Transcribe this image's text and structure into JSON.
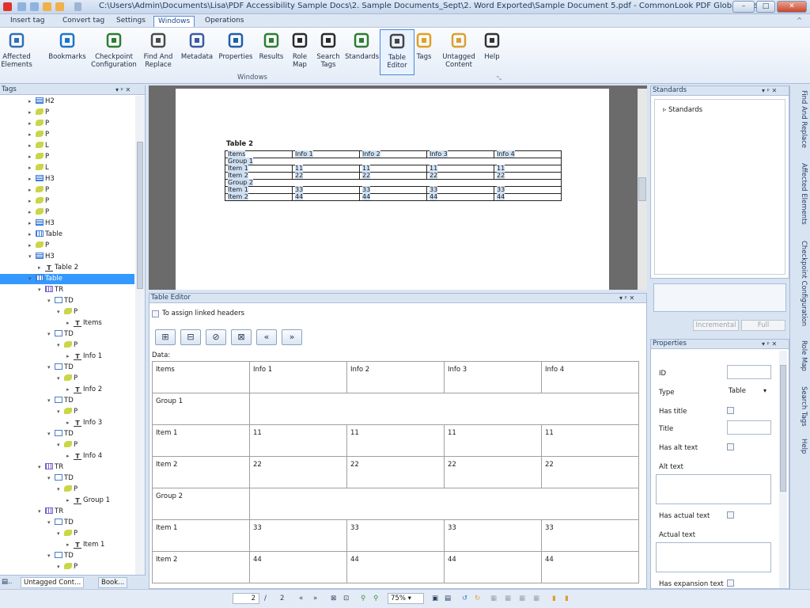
{
  "window": {
    "title": "C:\\Users\\Admin\\Documents\\Lisa\\PDF Accessibility Sample Docs\\2. Sample Documents_Sept\\2. Word Exported\\Sample Document 5.pdf - CommonLook PDF GlobalAccess",
    "min": "–",
    "max": "□",
    "close": "✕"
  },
  "menu": [
    "Insert tag",
    "Convert tag",
    "Settings",
    "Windows",
    "Operations"
  ],
  "ribbon": {
    "buttons": [
      {
        "label": "Affected\nElements",
        "icon": "affected-elements-icon"
      },
      {
        "label": "Bookmarks",
        "icon": "bookmark-icon"
      },
      {
        "label": "Checkpoint\nConfiguration",
        "icon": "checkpoint-icon"
      },
      {
        "label": "Find And\nReplace",
        "icon": "find-replace-icon"
      },
      {
        "label": "Metadata",
        "icon": "metadata-icon"
      },
      {
        "label": "Properties",
        "icon": "properties-icon"
      },
      {
        "label": "Results",
        "icon": "results-icon"
      },
      {
        "label": "Role\nMap",
        "icon": "role-map-icon"
      },
      {
        "label": "Search\nTags",
        "icon": "search-icon"
      },
      {
        "label": "Standards",
        "icon": "standards-icon"
      },
      {
        "label": "Table\nEditor",
        "icon": "table-editor-icon"
      },
      {
        "label": "Tags",
        "icon": "tag-icon"
      },
      {
        "label": "Untagged\nContent",
        "icon": "untagged-icon"
      },
      {
        "label": "Help",
        "icon": "help-icon"
      }
    ],
    "group_label": "Windows"
  },
  "tags_panel": {
    "title": "Tags",
    "pin": "▾ ᵖ ✕",
    "nodes": [
      {
        "label": "H2",
        "type": "h",
        "indent": 0,
        "arrow": "▸"
      },
      {
        "label": "P",
        "type": "p",
        "indent": 0,
        "arrow": "▸"
      },
      {
        "label": "P",
        "type": "p",
        "indent": 0,
        "arrow": "▸"
      },
      {
        "label": "P",
        "type": "p",
        "indent": 0,
        "arrow": "▸"
      },
      {
        "label": "L",
        "type": "l",
        "indent": 0,
        "arrow": "▸"
      },
      {
        "label": "P",
        "type": "p",
        "indent": 0,
        "arrow": "▸"
      },
      {
        "label": "L",
        "type": "l",
        "indent": 0,
        "arrow": "▸"
      },
      {
        "label": "H3",
        "type": "h",
        "indent": 0,
        "arrow": "▸"
      },
      {
        "label": "P",
        "type": "p",
        "indent": 0,
        "arrow": "▸"
      },
      {
        "label": "P",
        "type": "p",
        "indent": 0,
        "arrow": "▸"
      },
      {
        "label": "P",
        "type": "p",
        "indent": 0,
        "arrow": "▸"
      },
      {
        "label": "H3",
        "type": "h",
        "indent": 0,
        "arrow": "▸"
      },
      {
        "label": "Table",
        "type": "tbl",
        "indent": 0,
        "arrow": "▸"
      },
      {
        "label": "P",
        "type": "p",
        "indent": 0,
        "arrow": "▸"
      },
      {
        "label": "H3",
        "type": "h",
        "indent": 0,
        "arrow": "▾"
      },
      {
        "label": "Table 2",
        "type": "txt",
        "indent": 1,
        "arrow": "▸"
      },
      {
        "label": "Table",
        "type": "tbl",
        "indent": 0,
        "arrow": "▾",
        "selected": true
      },
      {
        "label": "TR",
        "type": "tr",
        "indent": 1,
        "arrow": "▾"
      },
      {
        "label": "TD",
        "type": "td",
        "indent": 2,
        "arrow": "▾"
      },
      {
        "label": "P",
        "type": "p",
        "indent": 3,
        "arrow": "▾"
      },
      {
        "label": "Items",
        "type": "txt",
        "indent": 4,
        "arrow": "▸"
      },
      {
        "label": "TD",
        "type": "td",
        "indent": 2,
        "arrow": "▾"
      },
      {
        "label": "P",
        "type": "p",
        "indent": 3,
        "arrow": "▾"
      },
      {
        "label": "Info 1",
        "type": "txt",
        "indent": 4,
        "arrow": "▸"
      },
      {
        "label": "TD",
        "type": "td",
        "indent": 2,
        "arrow": "▾"
      },
      {
        "label": "P",
        "type": "p",
        "indent": 3,
        "arrow": "▾"
      },
      {
        "label": "Info 2",
        "type": "txt",
        "indent": 4,
        "arrow": "▸"
      },
      {
        "label": "TD",
        "type": "td",
        "indent": 2,
        "arrow": "▾"
      },
      {
        "label": "P",
        "type": "p",
        "indent": 3,
        "arrow": "▾"
      },
      {
        "label": "Info 3",
        "type": "txt",
        "indent": 4,
        "arrow": "▸"
      },
      {
        "label": "TD",
        "type": "td",
        "indent": 2,
        "arrow": "▾"
      },
      {
        "label": "P",
        "type": "p",
        "indent": 3,
        "arrow": "▾"
      },
      {
        "label": "Info 4",
        "type": "txt",
        "indent": 4,
        "arrow": "▸"
      },
      {
        "label": "TR",
        "type": "tr",
        "indent": 1,
        "arrow": "▾"
      },
      {
        "label": "TD",
        "type": "td",
        "indent": 2,
        "arrow": "▾"
      },
      {
        "label": "P",
        "type": "p",
        "indent": 3,
        "arrow": "▾"
      },
      {
        "label": "Group 1",
        "type": "txt",
        "indent": 4,
        "arrow": "▸"
      },
      {
        "label": "TR",
        "type": "tr",
        "indent": 1,
        "arrow": "▾"
      },
      {
        "label": "TD",
        "type": "td",
        "indent": 2,
        "arrow": "▾"
      },
      {
        "label": "P",
        "type": "p",
        "indent": 3,
        "arrow": "▾"
      },
      {
        "label": "Item 1",
        "type": "txt",
        "indent": 4,
        "arrow": "▸"
      },
      {
        "label": "TD",
        "type": "td",
        "indent": 2,
        "arrow": "▾"
      },
      {
        "label": "P",
        "type": "p",
        "indent": 3,
        "arrow": "▾"
      }
    ]
  },
  "bottom_tabs": [
    "Untagged Cont...",
    "Book..."
  ],
  "document": {
    "table_title": "Table 2",
    "rows": [
      [
        "Items",
        "Info 1",
        "Info 2",
        "Info 3",
        "Info 4"
      ],
      [
        "Group 1",
        "",
        "",
        "",
        ""
      ],
      [
        "Item 1",
        "11",
        "11",
        "11",
        "11"
      ],
      [
        "Item 2",
        "22",
        "22",
        "22",
        "22"
      ],
      [
        "Group 2",
        "",
        "",
        "",
        ""
      ],
      [
        "Item 1",
        "33",
        "33",
        "33",
        "33"
      ],
      [
        "Item 2",
        "44",
        "44",
        "44",
        "44"
      ]
    ]
  },
  "table_editor": {
    "title": "Table Editor",
    "pin": "▾ ᵖ ✕",
    "linked_headers_label": "To assign linked headers",
    "data_label": "Data:",
    "toolbar": [
      "⊞",
      "⊟",
      "⊘",
      "⊠",
      "«",
      "»"
    ],
    "rows": [
      [
        "Items",
        "Info 1",
        "Info 2",
        "Info 3",
        "Info 4"
      ],
      [
        "Group 1",
        "",
        "",
        "",
        ""
      ],
      [
        "Item 1",
        "11",
        "11",
        "11",
        "11"
      ],
      [
        "Item 2",
        "22",
        "22",
        "22",
        "22"
      ],
      [
        "Group 2",
        "",
        "",
        "",
        ""
      ],
      [
        "Item 1",
        "33",
        "33",
        "33",
        "33"
      ],
      [
        "Item 2",
        "44",
        "44",
        "44",
        "44"
      ]
    ]
  },
  "standards_panel": {
    "title": "Standards",
    "pin": "▾ ᵖ ✕",
    "root": "Standards",
    "incremental": "Incremental",
    "full": "Full"
  },
  "properties_panel": {
    "title": "Properties",
    "pin": "▾ ᵖ ✕",
    "id_label": "ID",
    "type_label": "Type",
    "type_value": "Table",
    "has_title_label": "Has title",
    "title_label": "Title",
    "has_alt_text_label": "Has alt text",
    "alt_text_label": "Alt text",
    "has_actual_text_label": "Has actual text",
    "actual_text_label": "Actual text",
    "has_expansion_text_label": "Has expansion text"
  },
  "side_tabs": [
    "Find And Replace",
    "Affected Elements",
    "Checkpoint Configuration",
    "Role Map",
    "Search Tags",
    "Help"
  ],
  "status": {
    "page": "2",
    "sep": "/",
    "total": "2",
    "zoom": "75%",
    "nav_prev": "«",
    "nav_next": "»"
  },
  "colors": {
    "accent": "#3399ff",
    "ribbon_select": "#4b86d8"
  }
}
